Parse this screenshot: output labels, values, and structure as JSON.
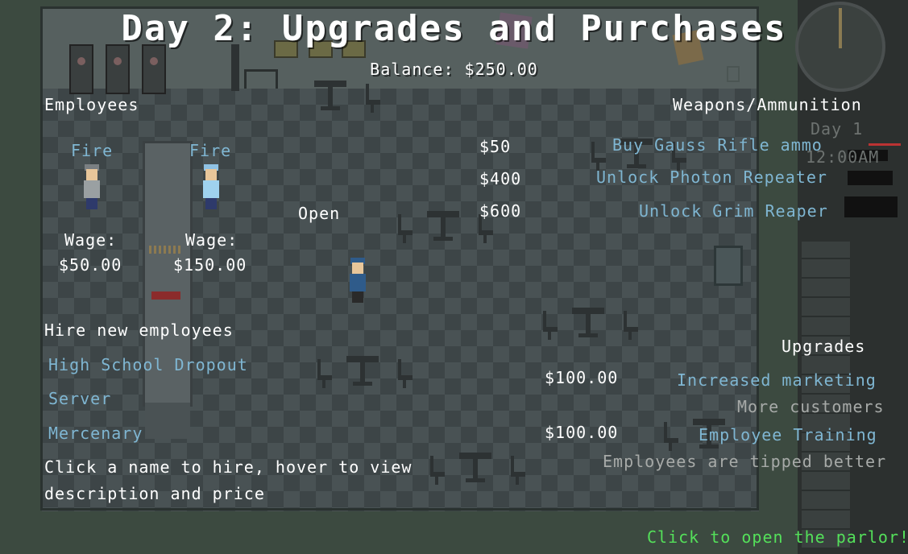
{
  "title": "Day 2: Upgrades and Purchases",
  "balance": "Balance: $250.00",
  "employees": {
    "heading": "Employees",
    "list": [
      {
        "fire_label": "Fire",
        "wage_label": "Wage:",
        "wage": "$50.00",
        "hat_color": "#7a7f82",
        "shirt_color": "#9aa0a2"
      },
      {
        "fire_label": "Fire",
        "wage_label": "Wage:",
        "wage": "$150.00",
        "hat_color": "#8fc2e4",
        "shirt_color": "#9fd2ee"
      }
    ]
  },
  "open_label": "Open",
  "hire": {
    "heading": "Hire new employees",
    "options": [
      "High School Dropout",
      "Server",
      "Mercenary"
    ],
    "hint_line1": "Click a name to hire, hover to view",
    "hint_line2": "description and price"
  },
  "weapons": {
    "heading": "Weapons/Ammunition",
    "items": [
      {
        "price": "$50",
        "label": "Buy Gauss Rifle ammo"
      },
      {
        "price": "$400",
        "label": "Unlock Photon Repeater"
      },
      {
        "price": "$600",
        "label": "Unlock Grim Reaper"
      }
    ]
  },
  "upgrades": {
    "heading": "Upgrades",
    "items": [
      {
        "price": "$100.00",
        "label": "Increased marketing",
        "description": "More customers"
      },
      {
        "price": "$100.00",
        "label": "Employee Training",
        "description": "Employees are tipped better"
      }
    ]
  },
  "hud": {
    "day": "Day 1",
    "time": "12:00AM"
  },
  "open_parlor": "Click to open the parlor!",
  "colors": {
    "link": "#7fb6d2",
    "green": "#54e05a",
    "white": "#ffffff",
    "gray": "#a7aaa8"
  }
}
